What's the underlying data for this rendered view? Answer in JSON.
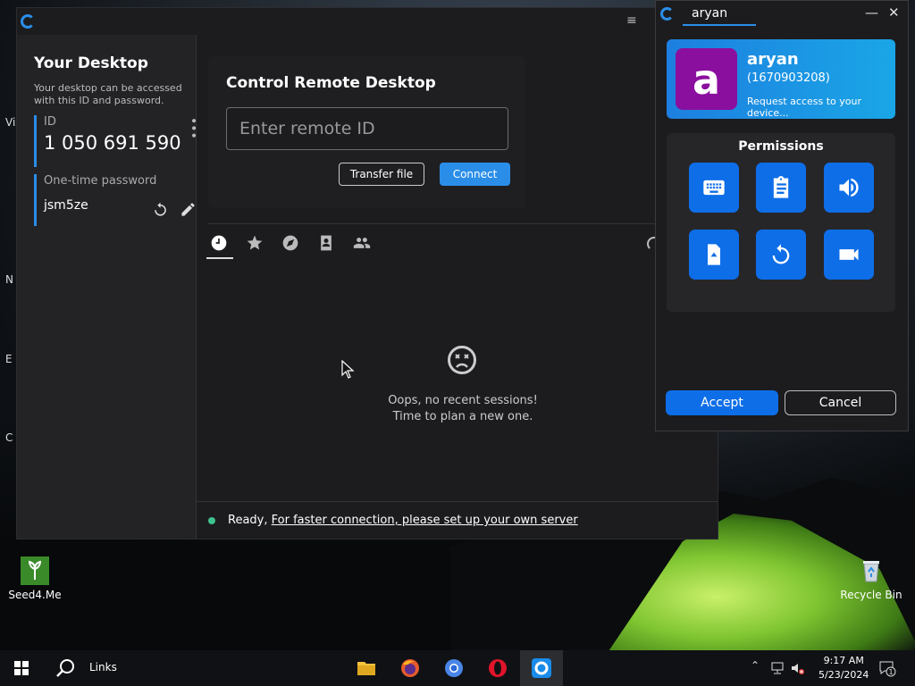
{
  "desktop": {
    "edge_letters": [
      "Vis",
      "N",
      "E",
      "C"
    ],
    "icons": [
      {
        "label": "Seed4.Me",
        "icon": "seed4me-icon"
      },
      {
        "label": "Recycle Bin",
        "icon": "recycle-bin-icon"
      }
    ]
  },
  "main": {
    "your_desktop_title": "Your Desktop",
    "your_desktop_desc": "Your desktop can be accessed with this ID and password.",
    "id_label": "ID",
    "id_value": "1 050 691 590",
    "password_label": "One-time password",
    "password_value": "jsm5ze",
    "control_title": "Control Remote Desktop",
    "remote_id_placeholder": "Enter remote ID",
    "transfer_label": "Transfer file",
    "connect_label": "Connect",
    "tabs": [
      "recent-sessions",
      "favorites",
      "discovered",
      "address-book",
      "group"
    ],
    "empty_line1": "Oops, no recent sessions!",
    "empty_line2": "Time to plan a new one.",
    "status_ready": "Ready,",
    "status_link": "For faster connection, please set up your own server"
  },
  "cm": {
    "title": "aryan",
    "user_name": "aryan",
    "user_id": "(1670903208)",
    "request_text": "Request access to your device...",
    "permissions_title": "Permissions",
    "permissions": [
      "keyboard-icon",
      "clipboard-icon",
      "audio-icon",
      "file-transfer-icon",
      "restart-icon",
      "recording-icon"
    ],
    "accept_label": "Accept",
    "cancel_label": "Cancel",
    "accent": "#0e6ee8"
  },
  "taskbar": {
    "links_label": "Links",
    "time": "9:17 AM",
    "date": "5/23/2024",
    "notification_count": "1"
  }
}
